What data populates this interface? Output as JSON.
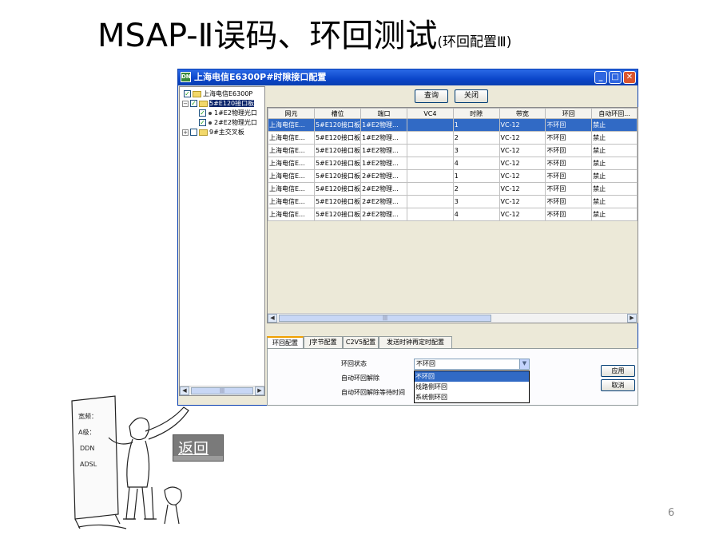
{
  "slide": {
    "title": "MSAP-Ⅱ误码、环回测试",
    "subtitle": "(环回配置Ⅲ)",
    "page_number": "6",
    "back_label": "返回"
  },
  "window": {
    "title": "上海电信E6300P#时隙接口配置",
    "icon_label": "DN"
  },
  "tree": {
    "root": "上海电信E6300P",
    "board": "5#E120接口板",
    "child1": "1#E2物理光口",
    "child2": "2#E2物理光口",
    "other": "9#主交叉板",
    "scroll_thumb": "|||"
  },
  "toolbar": {
    "query": "查询",
    "close": "关闭"
  },
  "table": {
    "columns": [
      "网元",
      "槽位",
      "端口",
      "VC4",
      "时隙",
      "带宽",
      "环回",
      "自动环回..."
    ],
    "rows": [
      [
        "上海电信E...",
        "5#E120接口板",
        "1#E2物理...",
        "",
        "1",
        "VC-12",
        "不环回",
        "禁止"
      ],
      [
        "上海电信E...",
        "5#E120接口板",
        "1#E2物理...",
        "",
        "2",
        "VC-12",
        "不环回",
        "禁止"
      ],
      [
        "上海电信E...",
        "5#E120接口板",
        "1#E2物理...",
        "",
        "3",
        "VC-12",
        "不环回",
        "禁止"
      ],
      [
        "上海电信E...",
        "5#E120接口板",
        "1#E2物理...",
        "",
        "4",
        "VC-12",
        "不环回",
        "禁止"
      ],
      [
        "上海电信E...",
        "5#E120接口板",
        "2#E2物理...",
        "",
        "1",
        "VC-12",
        "不环回",
        "禁止"
      ],
      [
        "上海电信E...",
        "5#E120接口板",
        "2#E2物理...",
        "",
        "2",
        "VC-12",
        "不环回",
        "禁止"
      ],
      [
        "上海电信E...",
        "5#E120接口板",
        "2#E2物理...",
        "",
        "3",
        "VC-12",
        "不环回",
        "禁止"
      ],
      [
        "上海电信E...",
        "5#E120接口板",
        "2#E2物理...",
        "",
        "4",
        "VC-12",
        "不环回",
        "禁止"
      ]
    ],
    "scroll_thumb": "|||"
  },
  "tabs": [
    "环回配置",
    "J字节配置",
    "C2V5配置",
    "发送时钟再定时配置"
  ],
  "panel": {
    "loop_state_label": "环回状态",
    "auto_release_label": "自动环回解除",
    "auto_release_wait_label": "自动环回解除等待时间",
    "loop_state_value": "不环回",
    "options": [
      "不环回",
      "线路侧环回",
      "系统侧环回"
    ],
    "apply": "应用",
    "cancel": "取消"
  },
  "cartoon": {
    "board_text": [
      "宽频：",
      "A级：",
      "DDN",
      "ADSL"
    ]
  }
}
